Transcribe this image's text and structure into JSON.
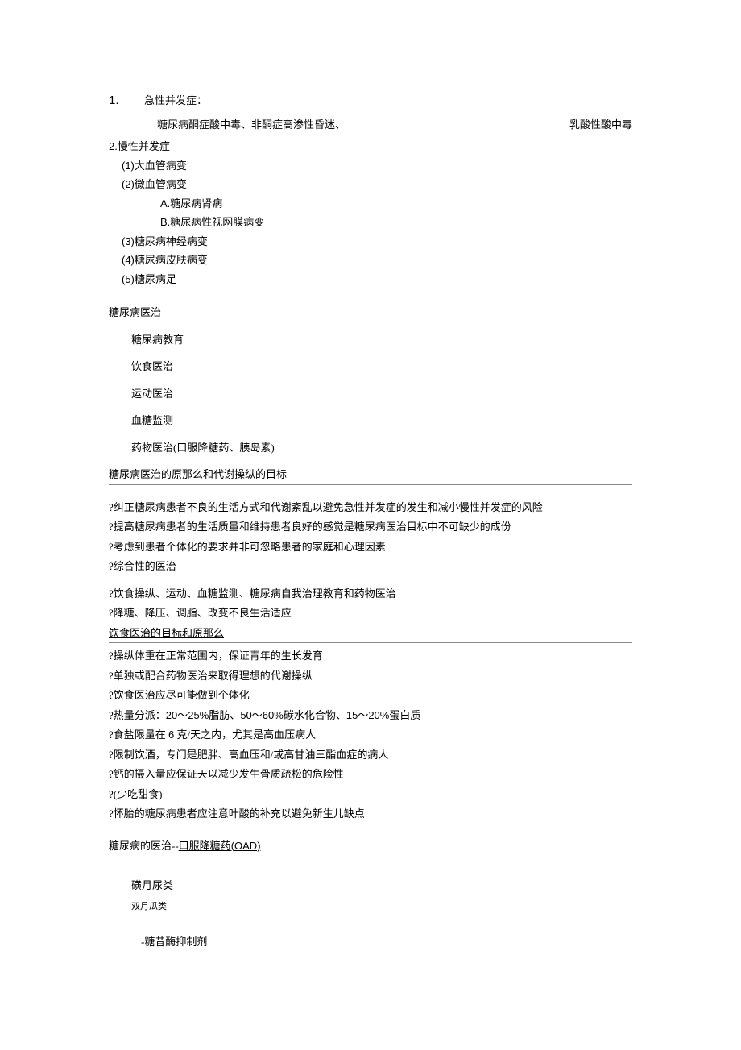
{
  "sec1": {
    "num": "1.",
    "title": "急性并发症：",
    "left": "糖尿病酮症酸中毒、非酮症高渗性昏迷、",
    "right": "乳酸性酸中毒"
  },
  "sec2": {
    "num": "2.",
    "title": "慢性并发症",
    "items": {
      "i1": "(1)大血管病变",
      "i2": "(2)微血管病变",
      "i2a": "A.糖尿病肾病",
      "i2b": "B.糖尿病性视网膜病变",
      "i3": "(3)糖尿病神经病变",
      "i4": "(4)糖尿病皮肤病变",
      "i5": "(5)糖尿病足"
    }
  },
  "treat": {
    "heading": "糖尿病医治",
    "t1": "糖尿病教育",
    "t2": "饮食医治",
    "t3": "运动医治",
    "t4": "血糖监测",
    "t5": "药物医治(口服降糖药、胰岛素)"
  },
  "principles": {
    "heading": "糖尿病医治的原那么和代谢操纵的目标",
    "p1": "?纠正糖尿病患者不良的生活方式和代谢紊乱以避免急性并发症的发生和减小慢性并发症的风险",
    "p2": "?提高糖尿病患者的生活质量和维持患者良好的感觉是糖尿病医治目标中不可缺少的成份",
    "p3": "?考虑到患者个体化的要求并非可忽略患者的家庭和心理因素",
    "p4": "?综合性的医治",
    "p5": "?饮食操纵、运动、血糖监测、糖尿病自我治理教育和药物医治",
    "p6": "?降糖、降压、调脂、改变不良生活适应"
  },
  "diet": {
    "heading": "饮食医治的目标和原那么",
    "d1": "?操纵体重在正常范围内，保证青年的生长发育",
    "d2": "?单独或配合药物医治来取得理想的代谢操纵",
    "d3": "?饮食医治应尽可能做到个体化",
    "d4": "?热量分派：20～25%脂肪、50～60%碳水化合物、15～20%蛋白质",
    "d5": "?食盐限量在 6 克/天之内，尤其是高血压病人",
    "d6": "?限制饮酒，专门是肥胖、高血压和/或高甘油三酯血症的病人",
    "d7": "?钙的摄入量应保证天以减少发生骨质疏松的危险性",
    "d8": "?(少吃甜食)",
    "d9": "?怀胎的糖尿病患者应注意叶酸的补充以避免新生儿缺点"
  },
  "oad": {
    "heading_prefix": "糖尿病的医治--",
    "heading_link": "口服降糖药(OAD)",
    "o1": "磺月尿类",
    "o2": "双月瓜类",
    "o3": "-糖昔酶抑制剂"
  }
}
